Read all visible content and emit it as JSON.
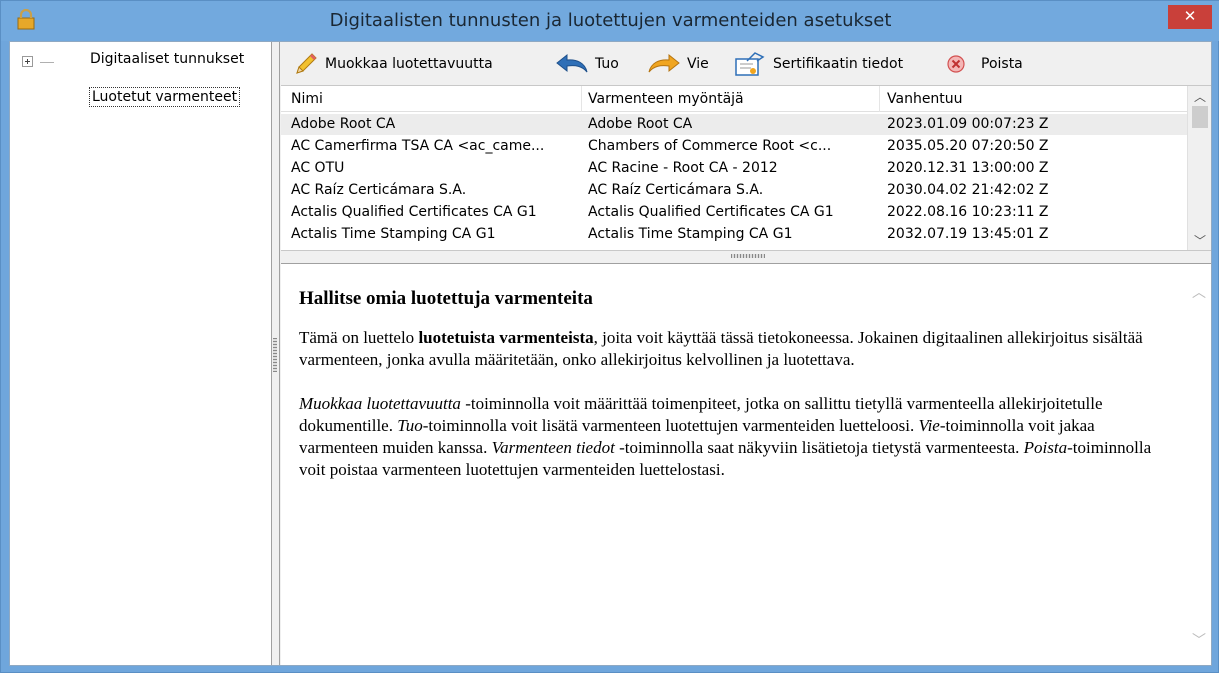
{
  "window": {
    "title": "Digitaalisten tunnusten ja luotettujen varmenteiden asetukset",
    "close_label": "✕"
  },
  "tree": {
    "items": [
      {
        "label": "Digitaaliset tunnukset"
      },
      {
        "label": "Luotetut varmenteet"
      }
    ]
  },
  "toolbar": {
    "edit_trust": "Muokkaa luotettavuutta",
    "import": "Tuo",
    "export": "Vie",
    "cert_details": "Sertifikaatin tiedot",
    "delete": "Poista"
  },
  "table": {
    "columns": [
      "Nimi",
      "Varmenteen myöntäjä",
      "Vanhentuu"
    ],
    "rows": [
      [
        "Adobe Root CA",
        "Adobe Root CA",
        "2023.01.09 00:07:23 Z"
      ],
      [
        "AC Camerfirma TSA CA <ac_came...",
        "Chambers of Commerce Root <c...",
        "2035.05.20 07:20:50 Z"
      ],
      [
        "AC OTU",
        "AC Racine - Root CA - 2012",
        "2020.12.31 13:00:00 Z"
      ],
      [
        "AC Raíz Certicámara S.A.",
        "AC Raíz Certicámara S.A.",
        "2030.04.02 21:42:02 Z"
      ],
      [
        "Actalis Qualified Certificates CA G1",
        "Actalis Qualified Certificates CA G1",
        "2022.08.16 10:23:11 Z"
      ],
      [
        "Actalis Time Stamping CA G1",
        "Actalis Time Stamping CA G1",
        "2032.07.19 13:45:01 Z"
      ]
    ]
  },
  "help": {
    "heading": "Hallitse omia luotettuja varmenteita",
    "p1_a": "Tämä on luettelo ",
    "p1_b": "luotetuista varmenteista",
    "p1_c": ", joita voit käyttää tässä tietokoneessa. Jokainen digitaalinen allekirjoitus sisältää varmenteen, jonka avulla määritetään, onko allekirjoitus kelvollinen ja luotettava.",
    "p2_a": "Muokkaa luotettavuutta",
    "p2_b": " -toiminnolla voit määrittää toimenpiteet, jotka on sallittu tietyllä varmenteella allekirjoitetulle dokumentille. ",
    "p2_c": "Tuo",
    "p2_d": "-toiminnolla voit lisätä varmenteen luotettujen varmenteiden luetteloosi. ",
    "p2_e": "Vie",
    "p2_f": "-toiminnolla voit jakaa varmenteen muiden kanssa. ",
    "p2_g": "Varmenteen tiedot",
    "p2_h": " -toiminnolla saat näkyviin lisätietoja tietystä varmenteesta. ",
    "p2_i": "Poista",
    "p2_j": "-toiminnolla voit poistaa varmenteen luotettujen varmenteiden luettelostasi."
  },
  "colors": {
    "titlebar": "#72a9de",
    "close": "#c9403a",
    "selected_row": "#ececec"
  }
}
